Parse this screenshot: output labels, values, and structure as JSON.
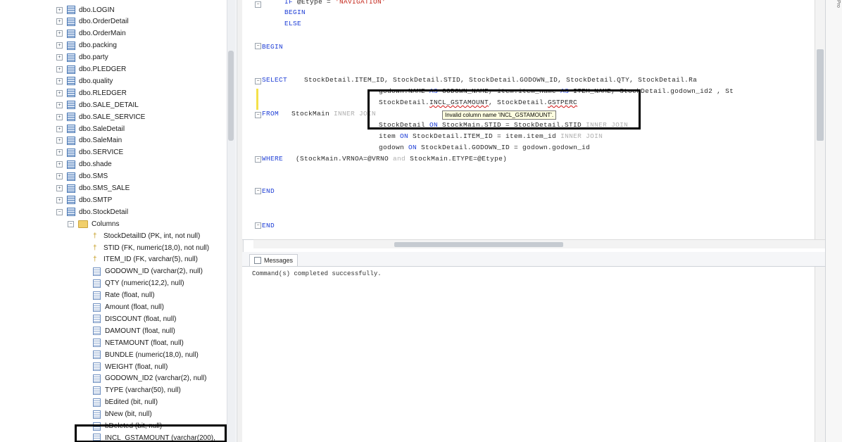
{
  "object_explorer": {
    "tables": [
      {
        "label": "dbo.LOGIN"
      },
      {
        "label": "dbo.OrderDetail"
      },
      {
        "label": "dbo.OrderMain"
      },
      {
        "label": "dbo.packing"
      },
      {
        "label": "dbo.party"
      },
      {
        "label": "dbo.PLEDGER"
      },
      {
        "label": "dbo.quality"
      },
      {
        "label": "dbo.RLEDGER"
      },
      {
        "label": "dbo.SALE_DETAIL"
      },
      {
        "label": "dbo.SALE_SERVICE"
      },
      {
        "label": "dbo.SaleDetail"
      },
      {
        "label": "dbo.SaleMain"
      },
      {
        "label": "dbo.SERVICE"
      },
      {
        "label": "dbo.shade"
      },
      {
        "label": "dbo.SMS"
      },
      {
        "label": "dbo.SMS_SALE"
      },
      {
        "label": "dbo.SMTP"
      },
      {
        "label": "dbo.StockDetail"
      }
    ],
    "columns_folder": "Columns",
    "columns": [
      {
        "label": "StockDetailID (PK, int, not null)",
        "icon": "key-icon"
      },
      {
        "label": "STID (FK, numeric(18,0), not null)",
        "icon": "key-icon"
      },
      {
        "label": "ITEM_ID (FK, varchar(5), null)",
        "icon": "key-icon"
      },
      {
        "label": "GODOWN_ID (varchar(2), null)",
        "icon": "column-icon"
      },
      {
        "label": "QTY (numeric(12,2), null)",
        "icon": "column-icon"
      },
      {
        "label": "Rate (float, null)",
        "icon": "column-icon"
      },
      {
        "label": "Amount (float, null)",
        "icon": "column-icon"
      },
      {
        "label": "DISCOUNT (float, null)",
        "icon": "column-icon"
      },
      {
        "label": "DAMOUNT (float, null)",
        "icon": "column-icon"
      },
      {
        "label": "NETAMOUNT (float, null)",
        "icon": "column-icon"
      },
      {
        "label": "BUNDLE (numeric(18,0), null)",
        "icon": "column-icon"
      },
      {
        "label": "WEIGHT (float, null)",
        "icon": "column-icon"
      },
      {
        "label": "GODOWN_ID2 (varchar(2), null)",
        "icon": "column-icon"
      },
      {
        "label": "TYPE (varchar(50), null)",
        "icon": "column-icon"
      },
      {
        "label": "bEdited (bit, null)",
        "icon": "column-icon"
      },
      {
        "label": "bNew (bit, null)",
        "icon": "column-icon"
      },
      {
        "label": "bDeleted (bit, null)",
        "icon": "column-icon"
      },
      {
        "label": "INCL_GSTAMOUNT (varchar(200),",
        "icon": "column-icon"
      }
    ]
  },
  "editor": {
    "line_if_kw": "IF",
    "line_if_rest": " @Etype =",
    "line_if_str": "'NAVIGATION'",
    "line_begin1": "BEGIN",
    "line_else": "ELSE",
    "line_begin2": "BEGIN",
    "select_kw": "SELECT",
    "select_cols": "    StockDetail.ITEM_ID, StockDetail.STID, StockDetail.GODOWN_ID, StockDetail.QTY, StockDetail.Ra",
    "line2_a": "godown.NAME",
    "line2_as1": " AS ",
    "line2_b": "GODOWN_NAME, item.item_name",
    "line2_as2": " AS ",
    "line2_c": "ITEM_NAME, StockDetail.godown_id2 , St",
    "line3_a": "StockDetail.",
    "line3_err": "INCL_GSTAMOUNT",
    "line3_b": ", StockDetail.",
    "line3_err2": "GSTPERC",
    "from_kw": "FROM",
    "from_table": "   StockMain",
    "from_join": " INNER JOIN",
    "line5_a": "StockDetail",
    "line5_on": " ON ",
    "line5_b": "StockMain.STID = StockDetail.STID",
    "line5_c": " INNER JOIN",
    "line6_a": "item",
    "line6_on": " ON ",
    "line6_b": "StockDetail.ITEM_ID = item.item_id",
    "line6_c": " INNER JOIN",
    "line7_a": "godown",
    "line7_on": " ON ",
    "line7_b": "StockDetail.GODOWN_ID = godown.godown_id",
    "where_kw": "WHERE",
    "where_rest": "   (StockMain.VRNOA=@VRNO",
    "where_and": " and ",
    "where_rest2": "StockMain.ETYPE=@Etype)",
    "end1": "END",
    "end2": "END",
    "tooltip": "Invalid column name 'INCL_GSTAMOUNT'."
  },
  "messages": {
    "tab_label": "Messages",
    "text": "Command(s) completed successfully."
  },
  "right_panel": {
    "tab_label": "Pro"
  }
}
